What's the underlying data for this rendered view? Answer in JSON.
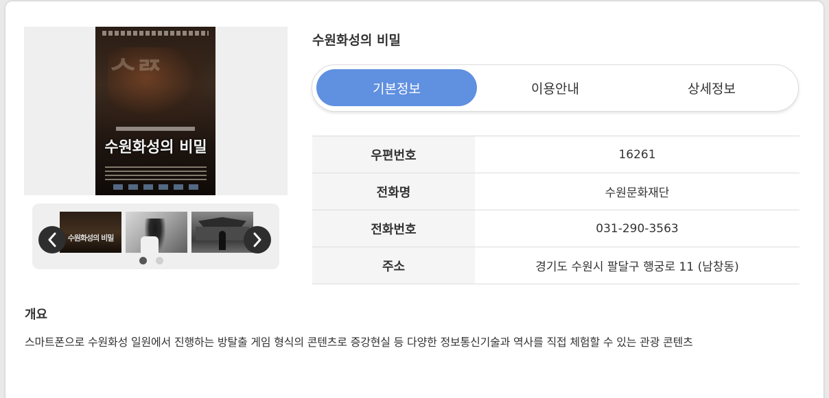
{
  "title": "수원화성의 비밀",
  "poster": {
    "title_text": "수원화성의 비밀",
    "thumb1_text": "수원화성의 비밀"
  },
  "tabs": [
    {
      "label": "기본정보",
      "active": true
    },
    {
      "label": "이용안내",
      "active": false
    },
    {
      "label": "상세정보",
      "active": false
    }
  ],
  "info": [
    {
      "label": "우편번호",
      "value": "16261"
    },
    {
      "label": "전화명",
      "value": "수원문화재단"
    },
    {
      "label": "전화번호",
      "value": "031-290-3563"
    },
    {
      "label": "주소",
      "value": "경기도 수원시 팔달구 행궁로 11 (남창동)"
    }
  ],
  "overview": {
    "heading": "개요",
    "text": "스마트폰으로 수원화성 일원에서 진행하는 방탈출 게임 형식의 콘텐츠로 증강현실 등 다양한 정보통신기술과 역사를 직접 체험할 수 있는 관광 콘텐츠"
  },
  "carousel": {
    "active_dot": 1,
    "dot_count": 2,
    "prev_icon": "chevron-left-icon",
    "next_icon": "chevron-right-icon"
  },
  "colors": {
    "accent": "#6090e0",
    "label_bg": "#f5f5f5",
    "background": "#e9e9e9"
  }
}
